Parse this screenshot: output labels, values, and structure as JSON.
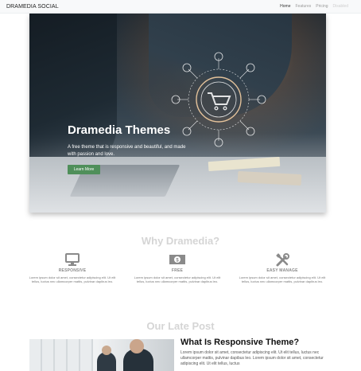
{
  "navbar": {
    "brand": "DRAMEDIA SOCIAL",
    "links": [
      {
        "label": "Home",
        "state": "active"
      },
      {
        "label": "Features",
        "state": "normal"
      },
      {
        "label": "Pricing",
        "state": "normal"
      },
      {
        "label": "Disabled",
        "state": "disabled"
      }
    ]
  },
  "hero": {
    "title": "Dramedia Themes",
    "text": "A free theme that is responsive and beautiful, and made with passion and love.",
    "button_label": "Learn More",
    "button_color": "#4f8f5a"
  },
  "features_section": {
    "title": "Why Dramedia?",
    "items": [
      {
        "icon": "monitor-icon",
        "title": "RESPONSIVE",
        "text": "Lorem ipsum dolor sit amet, consectetur adipiscing elit. Ut elit tellus, luctus nec ullamcorper mattis, pulvinar dapibus leo."
      },
      {
        "icon": "money-icon",
        "title": "FREE",
        "text": "Lorem ipsum dolor sit amet, consectetur adipiscing elit. Ut elit tellus, luctus nec ullamcorper mattis, pulvinar dapibus leo."
      },
      {
        "icon": "tools-icon",
        "title": "EASY MANAGE",
        "text": "Lorem ipsum dolor sit amet, consectetur adipiscing elit. Ut elit tellus, luctus nec ullamcorper mattis, pulvinar dapibus leo."
      }
    ]
  },
  "post_section": {
    "title": "Our Late Post",
    "post_title": "What Is Responsive Theme?",
    "post_text": "Lorem ipsum dolor sit amet, consectetur adipiscing elit. Ut elit tellus, luctus nec ullamcorper mattis, pulvinar dapibus leo. Lorem ipsum dolor sit amet, consectetur adipiscing elit. Ut elit tellus, luctus"
  },
  "colors": {
    "heading_muted": "#d5d5d5",
    "icon_gray": "#8a8a8a"
  }
}
